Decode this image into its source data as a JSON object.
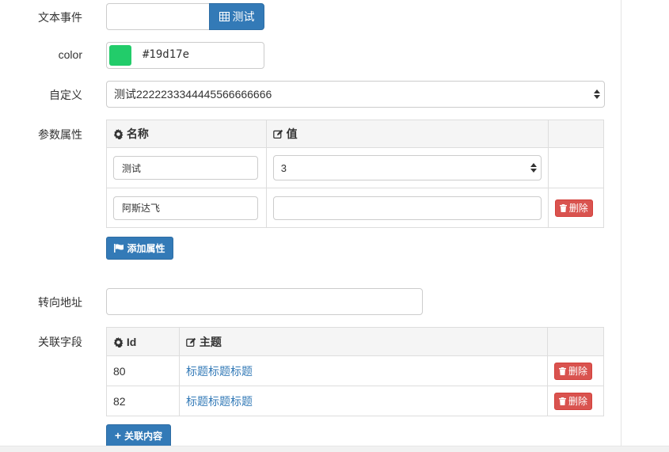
{
  "form": {
    "text_event": {
      "label": "文本事件",
      "value": "",
      "button_label": "测试",
      "button_icon": "table-icon"
    },
    "color": {
      "label": "color",
      "value": "#19d17e",
      "swatch_color": "#22cc6a"
    },
    "custom": {
      "label": "自定义",
      "selected": "测试2222233344445566666666"
    },
    "params": {
      "label": "参数属性",
      "columns": [
        {
          "label": "名称",
          "icon": "gear-icon"
        },
        {
          "label": "值",
          "icon": "edit-icon"
        },
        {
          "label": ""
        }
      ],
      "rows": [
        {
          "name": "测试",
          "value": "3",
          "value_type": "select",
          "action": ""
        },
        {
          "name": "阿斯达飞",
          "value": "",
          "value_type": "input",
          "action": "删除"
        }
      ],
      "add_button": "添加属性"
    },
    "redirect": {
      "label": "转向地址",
      "value": ""
    },
    "related": {
      "label": "关联字段",
      "columns": [
        {
          "label": "Id",
          "icon": "gear-icon"
        },
        {
          "label": "主题",
          "icon": "edit-icon"
        },
        {
          "label": ""
        }
      ],
      "rows": [
        {
          "id": "80",
          "title": "标题标题标题",
          "action": "删除"
        },
        {
          "id": "82",
          "title": "标题标题标题",
          "action": "删除"
        }
      ],
      "add_button": "关联内容"
    }
  },
  "colors": {
    "primary": "#337ab7",
    "danger": "#d9534f",
    "link": "#337ab7"
  }
}
